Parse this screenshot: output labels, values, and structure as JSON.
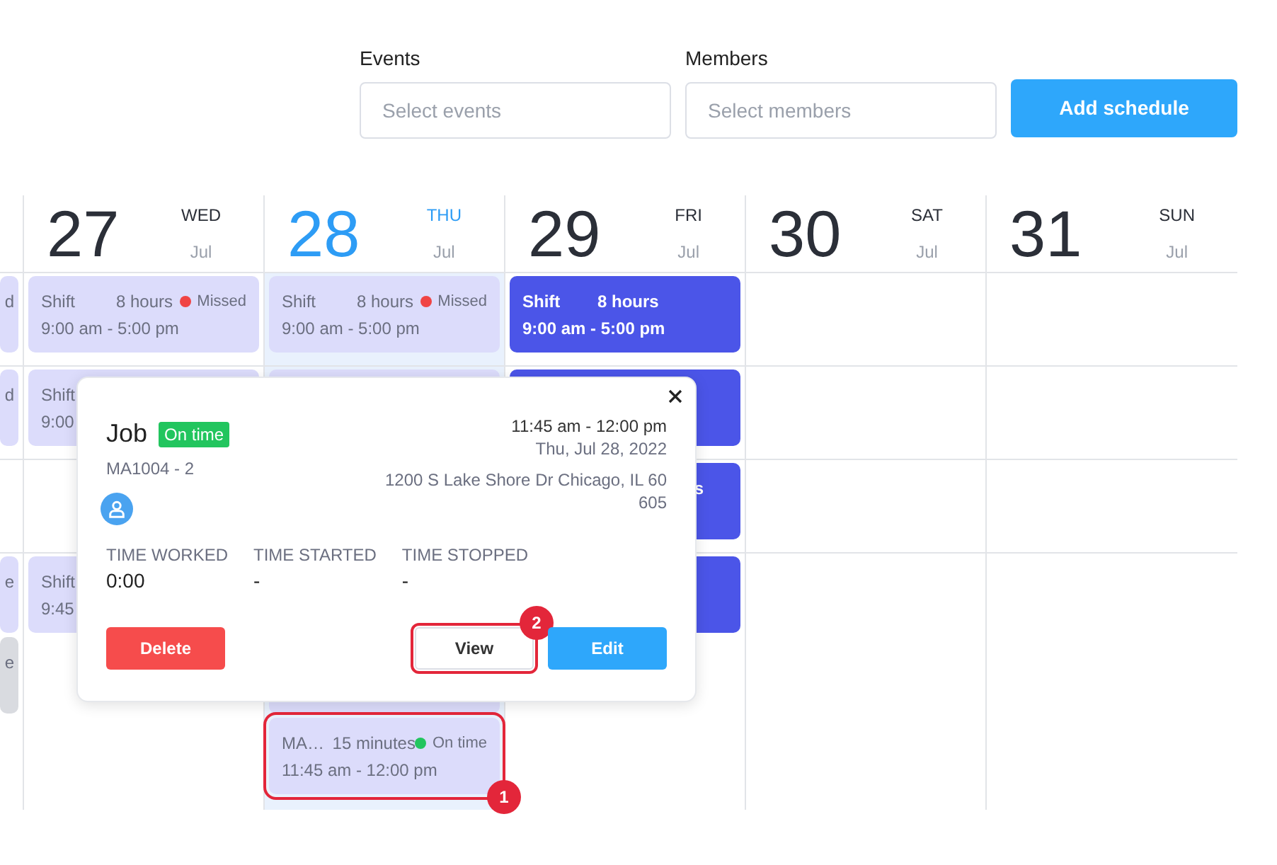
{
  "filters": [
    {
      "label": "Events",
      "placeholder": "Select events"
    },
    {
      "label": "Members",
      "placeholder": "Select members"
    }
  ],
  "add_button": "Add schedule",
  "columns": [
    {
      "events": [
        {
          "color": "#dcdcfb",
          "tail": "d"
        },
        {
          "color": "#dcdcfb",
          "tail": "d"
        },
        {
          "color": "#dcdcfb",
          "tail": "e"
        },
        {
          "color": "#d9dbe0",
          "tail": "e"
        }
      ]
    },
    {
      "day": {
        "number": "27",
        "weekday": "WED",
        "month": "Jul",
        "selected": false
      },
      "events": [
        {
          "color": "#dcdcfb",
          "title": "Shift",
          "duration": "8 hours",
          "status": {
            "label": "Missed",
            "color": "#f04444"
          },
          "time": "9:00 am - 5:00 pm"
        },
        {
          "color": "#dcdcfb",
          "title": "Shift",
          "time": "9:00"
        },
        {
          "color": "#dcdcfb",
          "title": "Shift",
          "time": "9:45"
        }
      ]
    },
    {
      "day": {
        "number": "28",
        "weekday": "THU",
        "month": "Jul",
        "selected": true
      },
      "events": [
        {
          "color": "#dcdcfb",
          "title": "Shift",
          "duration": "8 hours",
          "status": {
            "label": "Missed",
            "color": "#f04444"
          },
          "time": "9:00 am - 5:00 pm"
        },
        {
          "color": "#dcdcfb"
        },
        {
          "color": "#dcdcfb"
        },
        {
          "color": "#dcdcfb",
          "title": "MA…",
          "duration": "15 minutes",
          "status": {
            "label": "On time",
            "color": "#22c55e"
          },
          "time": "11:45 am - 12:00 pm",
          "highlighted": true,
          "marker": "1"
        }
      ]
    },
    {
      "day": {
        "number": "29",
        "weekday": "FRI",
        "month": "Jul",
        "selected": false
      },
      "events": [
        {
          "color": "#4b55e8",
          "title": "Shift",
          "duration": "8 hours",
          "time": "9:00 am - 5:00 pm"
        },
        {
          "color": "#4b55e8"
        },
        {
          "color": "#4b55e8",
          "tail": "s"
        },
        {
          "color": "#4b55e8"
        }
      ]
    },
    {
      "day": {
        "number": "30",
        "weekday": "SAT",
        "month": "Jul",
        "selected": false
      }
    },
    {
      "day": {
        "number": "31",
        "weekday": "SUN",
        "month": "Jul",
        "selected": false
      }
    }
  ],
  "popover": {
    "title": "Job",
    "badge": "On time",
    "code": "MA1004 - 2",
    "time": "11:45 am - 12:00 pm",
    "date": "Thu, Jul 28, 2022",
    "address": "1200 S Lake Shore Dr Chicago, IL 60605",
    "stats": [
      {
        "label": "TIME WORKED",
        "value": "0:00"
      },
      {
        "label": "TIME STARTED",
        "value": "-"
      },
      {
        "label": "TIME STOPPED",
        "value": "-"
      }
    ],
    "buttons": [
      {
        "kind": "danger",
        "label": "Delete"
      },
      {
        "kind": "outline",
        "label": "View",
        "highlighted": true,
        "marker": "2"
      },
      {
        "kind": "primary",
        "label": "Edit"
      }
    ]
  }
}
